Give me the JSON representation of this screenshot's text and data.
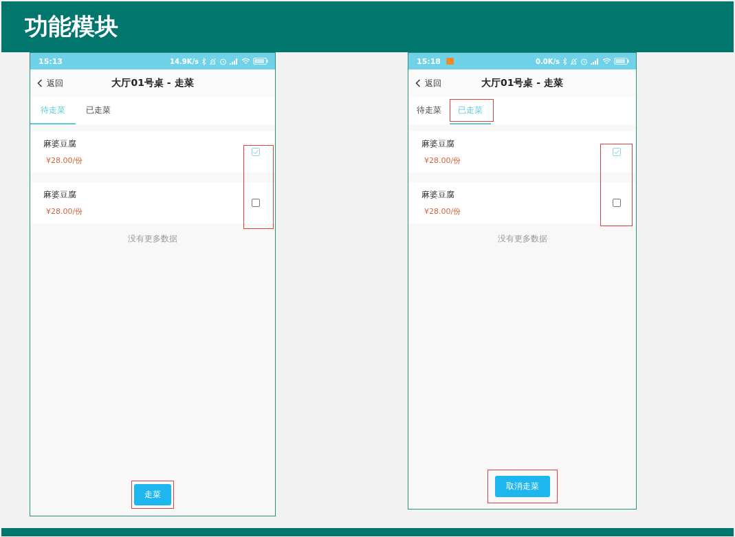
{
  "slide": {
    "title": "功能模块"
  },
  "phones": [
    {
      "status_bar": {
        "time": "15:13",
        "speed": "14.9K/s",
        "app_badge": false
      },
      "back_label": "返回",
      "title": "大厅01号桌 - 走菜",
      "tabs": [
        {
          "label": "待走菜",
          "selected": true,
          "highlighted": false
        },
        {
          "label": "已走菜",
          "selected": false,
          "highlighted": false
        }
      ],
      "dishes": [
        {
          "name": "麻婆豆腐",
          "price": "¥28.00/份",
          "checked": true
        },
        {
          "name": "麻婆豆腐",
          "price": "¥28.00/份",
          "checked": false
        }
      ],
      "checkboxes_highlighted": true,
      "list_end": "没有更多数据",
      "action_button": {
        "label": "走菜",
        "highlighted": true
      }
    },
    {
      "status_bar": {
        "time": "15:18",
        "speed": "0.0K/s",
        "app_badge": true
      },
      "back_label": "返回",
      "title": "大厅01号桌 - 走菜",
      "tabs": [
        {
          "label": "待走菜",
          "selected": false,
          "highlighted": false
        },
        {
          "label": "已走菜",
          "selected": true,
          "highlighted": true
        }
      ],
      "dishes": [
        {
          "name": "麻婆豆腐",
          "price": "¥28.00/份",
          "checked": true
        },
        {
          "name": "麻婆豆腐",
          "price": "¥28.00/份",
          "checked": false
        }
      ],
      "checkboxes_highlighted": true,
      "list_end": "没有更多数据",
      "action_button": {
        "label": "取消走菜",
        "highlighted": true
      }
    }
  ]
}
